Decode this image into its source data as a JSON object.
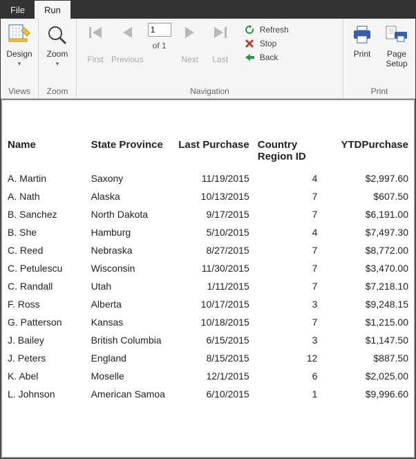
{
  "tabs": {
    "file": "File",
    "run": "Run"
  },
  "ribbon": {
    "views": {
      "design": "Design",
      "label": "Views"
    },
    "zoom": {
      "zoom": "Zoom",
      "label": "Zoom"
    },
    "nav": {
      "first": "First",
      "previous": "Previous",
      "next": "Next",
      "last": "Last",
      "page_current": "1",
      "page_total": "1",
      "of": "of",
      "refresh": "Refresh",
      "stop": "Stop",
      "back": "Back",
      "label": "Navigation"
    },
    "print": {
      "print": "Print",
      "page_setup": "Page\nSetup",
      "label": "Print"
    }
  },
  "report": {
    "headers": {
      "name": "Name",
      "state": "State Province",
      "last": "Last Purchase",
      "region": "Country Region ID",
      "ytd": "YTDPurchase"
    },
    "rows": [
      {
        "name": "A. Martin",
        "state": "Saxony",
        "last": "11/19/2015",
        "region": "4",
        "ytd": "$2,997.60"
      },
      {
        "name": "A. Nath",
        "state": "Alaska",
        "last": "10/13/2015",
        "region": "7",
        "ytd": "$607.50"
      },
      {
        "name": "B. Sanchez",
        "state": "North Dakota",
        "last": "9/17/2015",
        "region": "7",
        "ytd": "$6,191.00"
      },
      {
        "name": "B. She",
        "state": "Hamburg",
        "last": "5/10/2015",
        "region": "4",
        "ytd": "$7,497.30"
      },
      {
        "name": "C. Reed",
        "state": "Nebraska",
        "last": "8/27/2015",
        "region": "7",
        "ytd": "$8,772.00"
      },
      {
        "name": "C. Petulescu",
        "state": "Wisconsin",
        "last": "11/30/2015",
        "region": "7",
        "ytd": "$3,470.00"
      },
      {
        "name": "C. Randall",
        "state": "Utah",
        "last": "1/11/2015",
        "region": "7",
        "ytd": "$7,218.10"
      },
      {
        "name": "F. Ross",
        "state": "Alberta",
        "last": "10/17/2015",
        "region": "3",
        "ytd": "$9,248.15"
      },
      {
        "name": "G. Patterson",
        "state": "Kansas",
        "last": "10/18/2015",
        "region": "7",
        "ytd": "$1,215.00"
      },
      {
        "name": "J. Bailey",
        "state": "British Columbia",
        "last": "6/15/2015",
        "region": "3",
        "ytd": "$1,147.50"
      },
      {
        "name": "J. Peters",
        "state": "England",
        "last": "8/15/2015",
        "region": "12",
        "ytd": "$887.50"
      },
      {
        "name": "K. Abel",
        "state": "Moselle",
        "last": "12/1/2015",
        "region": "6",
        "ytd": "$2,025.00"
      },
      {
        "name": "L. Johnson",
        "state": "American Samoa",
        "last": "6/10/2015",
        "region": "1",
        "ytd": "$9,996.60"
      }
    ]
  }
}
